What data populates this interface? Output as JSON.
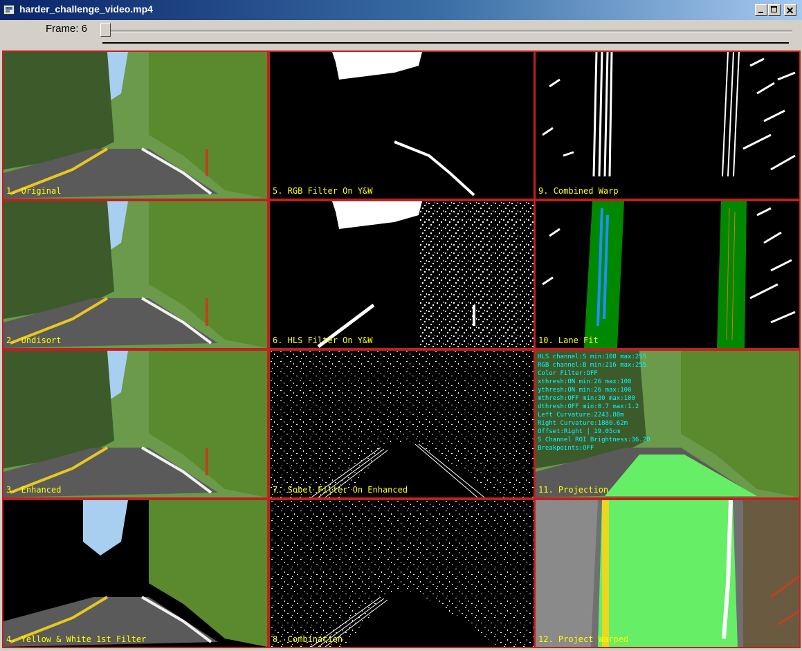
{
  "window": {
    "title": "harder_challenge_video.mp4",
    "controls": [
      "minimize-icon",
      "maximize-icon",
      "close-icon"
    ]
  },
  "toolbar": {
    "frame_label": "Frame: 6",
    "frame_value": 6
  },
  "colors": {
    "border": "#c02020",
    "label": "#ffff00",
    "overlay_text": "#00ffff",
    "lane_fill": "#66ee66",
    "lane_fit": "#008800"
  },
  "panels": {
    "p1": {
      "label": "1. Original"
    },
    "p2": {
      "label": "2. Undisort"
    },
    "p3": {
      "label": "3. Enhanced"
    },
    "p4": {
      "label": "4. Yellow & White 1st Filter"
    },
    "p5": {
      "label": "5. RGB Filter On Y&W"
    },
    "p6": {
      "label": "6. HLS Filter On Y&W"
    },
    "p7": {
      "label": "7. Sobel Filter On Enhanced"
    },
    "p8": {
      "label": "8. Combination"
    },
    "p9": {
      "label": "9. Combined Warp"
    },
    "p10": {
      "label": "10. Lane Fit"
    },
    "p11": {
      "label": "11. Projection"
    },
    "p12": {
      "label": "12. Project Warped"
    }
  },
  "overlay": [
    "HLS channel:S min:108 max:255",
    "RGB channel:B min:216 max:255",
    "Color Filter:OFF",
    "xthresh:ON min:26 max:100",
    "ythresh:ON min:26 max:100",
    "mthresh:OFF min:30 max:100",
    "dthresh:OFF min:0.7 max:1.2",
    "Left Curvature:2243.88m",
    "Right Curvature:1880.62m",
    "Offset:Right | 19.05cm",
    "S Channel ROI Brightness:36.20",
    "Breakpoints:OFF"
  ]
}
